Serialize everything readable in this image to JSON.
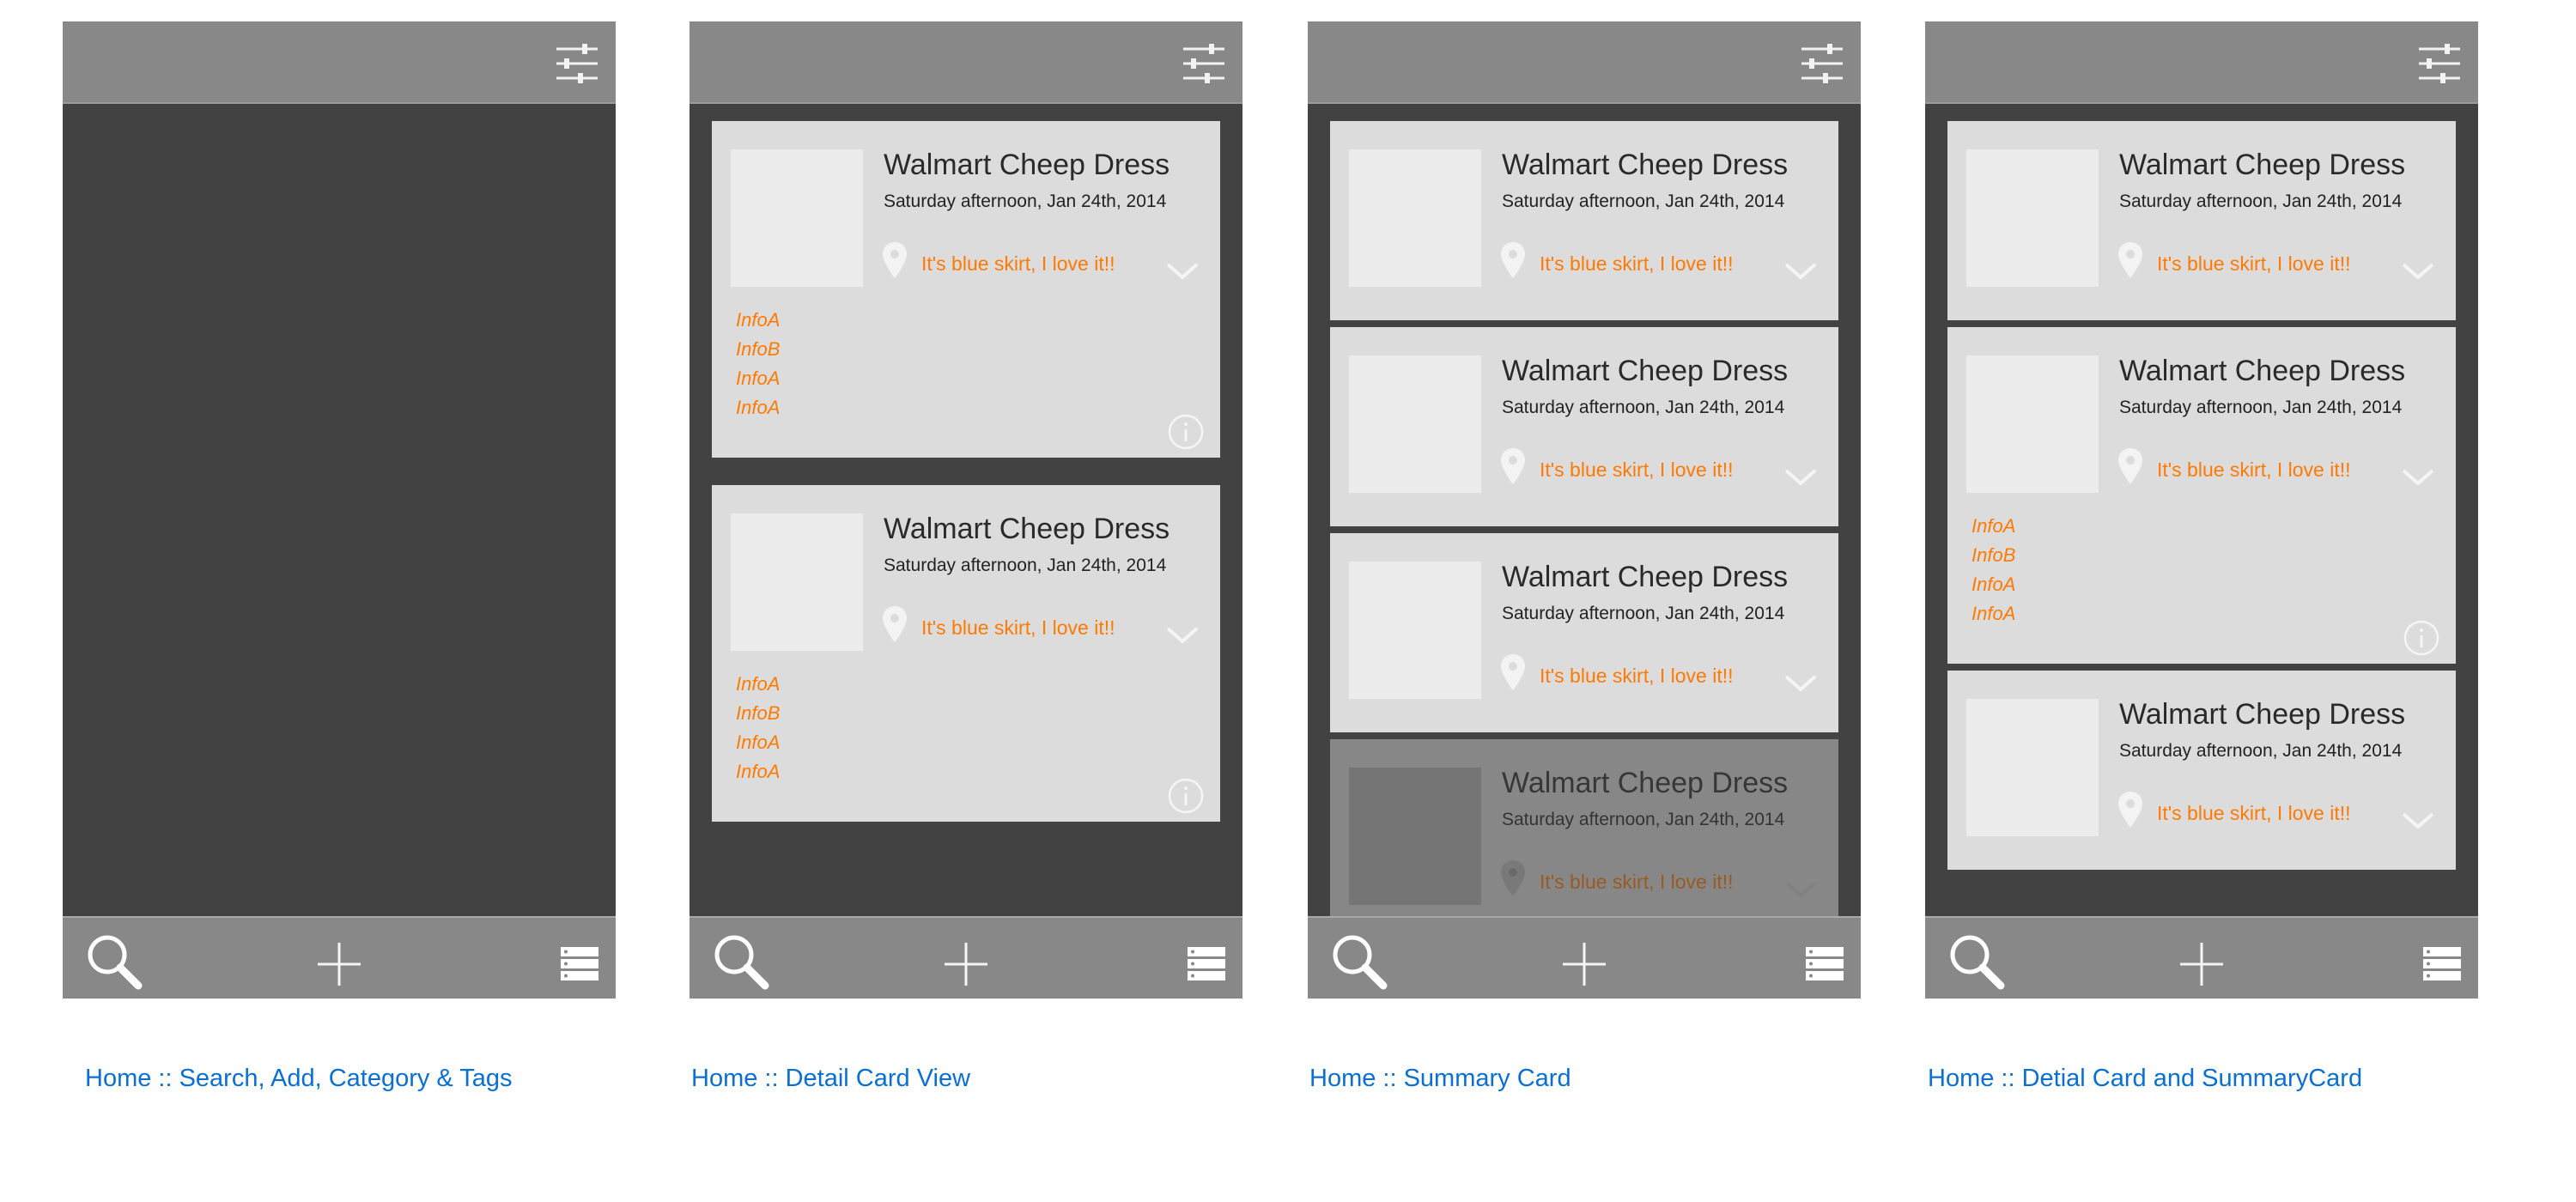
{
  "screens": [
    {
      "caption": "Home :: Search, Add, Category & Tags",
      "cards": []
    },
    {
      "caption": "Home :: Detail Card View",
      "cards": [
        {
          "title": "Walmart Cheep Dress",
          "date": "Saturday afternoon, Jan 24th, 2014",
          "comment": "It's blue skirt, I love it!!",
          "infos": [
            "InfoA",
            "InfoB",
            "InfoA",
            "InfoA"
          ]
        },
        {
          "title": "Walmart Cheep Dress",
          "date": "Saturday afternoon, Jan 24th, 2014",
          "comment": "It's blue skirt, I love it!!",
          "infos": [
            "InfoA",
            "InfoB",
            "InfoA",
            "InfoA"
          ]
        }
      ]
    },
    {
      "caption": "Home :: Summary Card",
      "cards": [
        {
          "title": "Walmart Cheep Dress",
          "date": "Saturday afternoon, Jan 24th, 2014",
          "comment": "It's blue skirt, I love it!!"
        },
        {
          "title": "Walmart Cheep Dress",
          "date": "Saturday afternoon, Jan 24th, 2014",
          "comment": "It's blue skirt, I love it!!"
        },
        {
          "title": "Walmart Cheep Dress",
          "date": "Saturday afternoon, Jan 24th, 2014",
          "comment": "It's blue skirt, I love it!!"
        },
        {
          "title": "Walmart Cheep Dress",
          "date": "Saturday afternoon, Jan 24th, 2014",
          "comment": "It's blue skirt, I love it!!"
        }
      ]
    },
    {
      "caption": "Home :: Detial Card and SummaryCard",
      "cards": [
        {
          "title": "Walmart Cheep Dress",
          "date": "Saturday afternoon, Jan 24th, 2014",
          "comment": "It's blue skirt, I love it!!"
        },
        {
          "title": "Walmart Cheep Dress",
          "date": "Saturday afternoon, Jan 24th, 2014",
          "comment": "It's blue skirt, I love it!!",
          "infos": [
            "InfoA",
            "InfoB",
            "InfoA",
            "InfoA"
          ]
        },
        {
          "title": "Walmart Cheep Dress",
          "date": "Saturday afternoon, Jan 24th, 2014",
          "comment": "It's blue skirt, I love it!!"
        }
      ]
    }
  ],
  "icons": {
    "top_right": "filter-sliders-icon",
    "bottom_left": "search-icon",
    "bottom_center": "plus-icon",
    "bottom_right": "menu-list-icon",
    "card_location": "map-pin-icon",
    "card_expand": "chevron-down-icon",
    "card_info": "info-icon"
  },
  "colors": {
    "bar": "#888888",
    "screen_background": "#424242",
    "card": "#dcdcdc",
    "thumbnail": "#ececec",
    "accent_orange": "#ff7a00",
    "caption_blue": "#0a6fd0"
  }
}
